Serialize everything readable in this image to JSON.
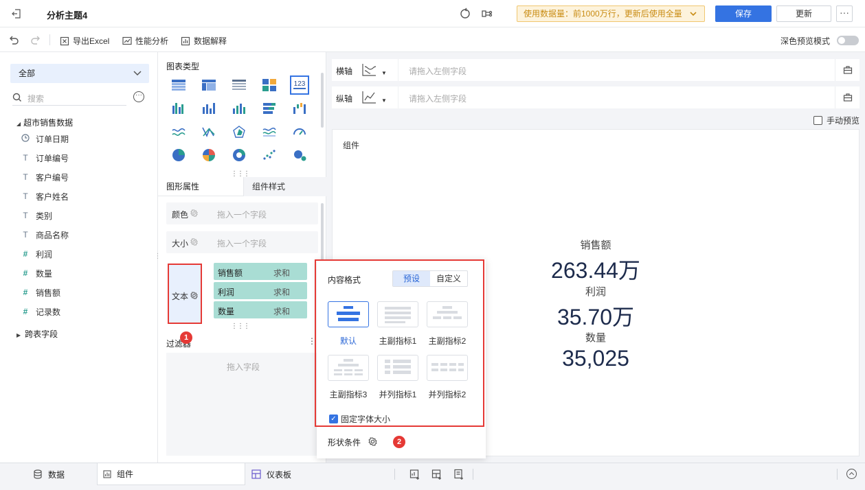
{
  "header": {
    "title": "分析主题4",
    "usage_notice": "使用数据量：前1000万行，更新后使用全量",
    "save_label": "保存",
    "update_label": "更新",
    "more_label": "···"
  },
  "toolbar": {
    "export_label": "导出Excel",
    "perf_label": "性能分析",
    "explain_label": "数据解释",
    "dark_preview_label": "深色预览模式"
  },
  "data_panel": {
    "scope_selected": "全部",
    "search_placeholder": "搜索",
    "table_name": "超市销售数据",
    "fields": [
      {
        "name": "订单日期",
        "type": "date",
        "icon": "clock-icon"
      },
      {
        "name": "订单编号",
        "type": "text",
        "icon": "T"
      },
      {
        "name": "客户编号",
        "type": "text",
        "icon": "T"
      },
      {
        "name": "客户姓名",
        "type": "text",
        "icon": "T"
      },
      {
        "name": "类别",
        "type": "text",
        "icon": "T"
      },
      {
        "name": "商品名称",
        "type": "text",
        "icon": "T"
      },
      {
        "name": "利润",
        "type": "number",
        "icon": "#"
      },
      {
        "name": "数量",
        "type": "number",
        "icon": "#"
      },
      {
        "name": "销售额",
        "type": "number",
        "icon": "#"
      },
      {
        "name": "记录数",
        "type": "number",
        "icon": "#"
      }
    ],
    "cross_table_label": "跨表字段"
  },
  "config_panel": {
    "chart_type_title": "图表类型",
    "tabs": [
      "图形属性",
      "组件样式"
    ],
    "properties": {
      "color_label": "颜色",
      "size_label": "大小",
      "drop_one_field": "拖入一个字段",
      "text_label": "文本"
    },
    "text_fields": [
      {
        "name": "销售额",
        "agg": "求和"
      },
      {
        "name": "利润",
        "agg": "求和"
      },
      {
        "name": "数量",
        "agg": "求和"
      }
    ],
    "filter_title": "过滤器",
    "filter_placeholder": "拖入字段",
    "markers": [
      "1",
      "2"
    ]
  },
  "popup": {
    "title": "内容格式",
    "segments": [
      "预设",
      "自定义"
    ],
    "formats": [
      "默认",
      "主副指标1",
      "主副指标2",
      "主副指标3",
      "并列指标1",
      "并列指标2"
    ],
    "fixed_font_label": "固定字体大小",
    "fixed_font_checked": true,
    "shape_condition_label": "形状条件"
  },
  "axes": {
    "x_label": "横轴",
    "y_label": "纵轴",
    "placeholder": "请拖入左侧字段"
  },
  "canvas": {
    "manual_preview_label": "手动预览",
    "component_label": "组件",
    "metrics": [
      {
        "name": "销售额",
        "value": "263.44万"
      },
      {
        "name": "利润",
        "value": "35.70万"
      },
      {
        "name": "数量",
        "value": "35,025"
      }
    ]
  },
  "bottom": {
    "tabs": [
      "数据",
      "组件",
      "仪表板"
    ]
  },
  "colors": {
    "accent": "#3473e2",
    "highlight_red": "#e53935",
    "pill_teal": "#a9ddd4",
    "notice_bg": "#fdf3dc"
  }
}
